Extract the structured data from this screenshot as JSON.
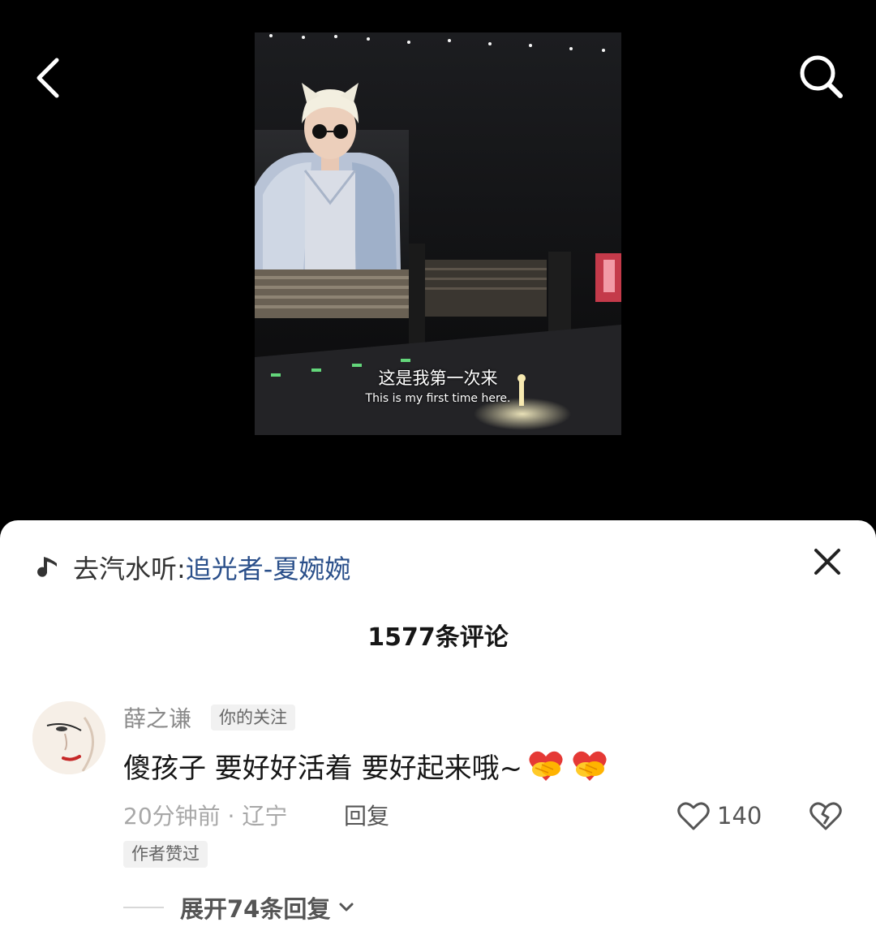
{
  "header": {
    "back_icon": "chevron-left-icon",
    "search_icon": "search-icon"
  },
  "video": {
    "subtitle_cn": "这是我第一次来",
    "subtitle_en": "This is my first time here."
  },
  "music": {
    "icon": "music-note-icon",
    "prefix": "去汽水听:",
    "track": "追光者-夏婉婉"
  },
  "comments_header": {
    "count_label": "1577条评论",
    "close_icon": "close-icon"
  },
  "comment": {
    "username": "薛之谦",
    "follow_badge": "你的关注",
    "text": "傻孩子 要好好活着 要好起来哦~",
    "emojis": [
      "heart-hands-emoji",
      "heart-hands-emoji"
    ],
    "meta": "20分钟前 · 辽宁",
    "reply_label": "回复",
    "like_count": "140",
    "author_badge": "作者赞过",
    "expand_label": "展开74条回复"
  },
  "colors": {
    "link": "#2a4f8a",
    "sheet_bg": "#ffffff",
    "top_bg": "#000000"
  }
}
